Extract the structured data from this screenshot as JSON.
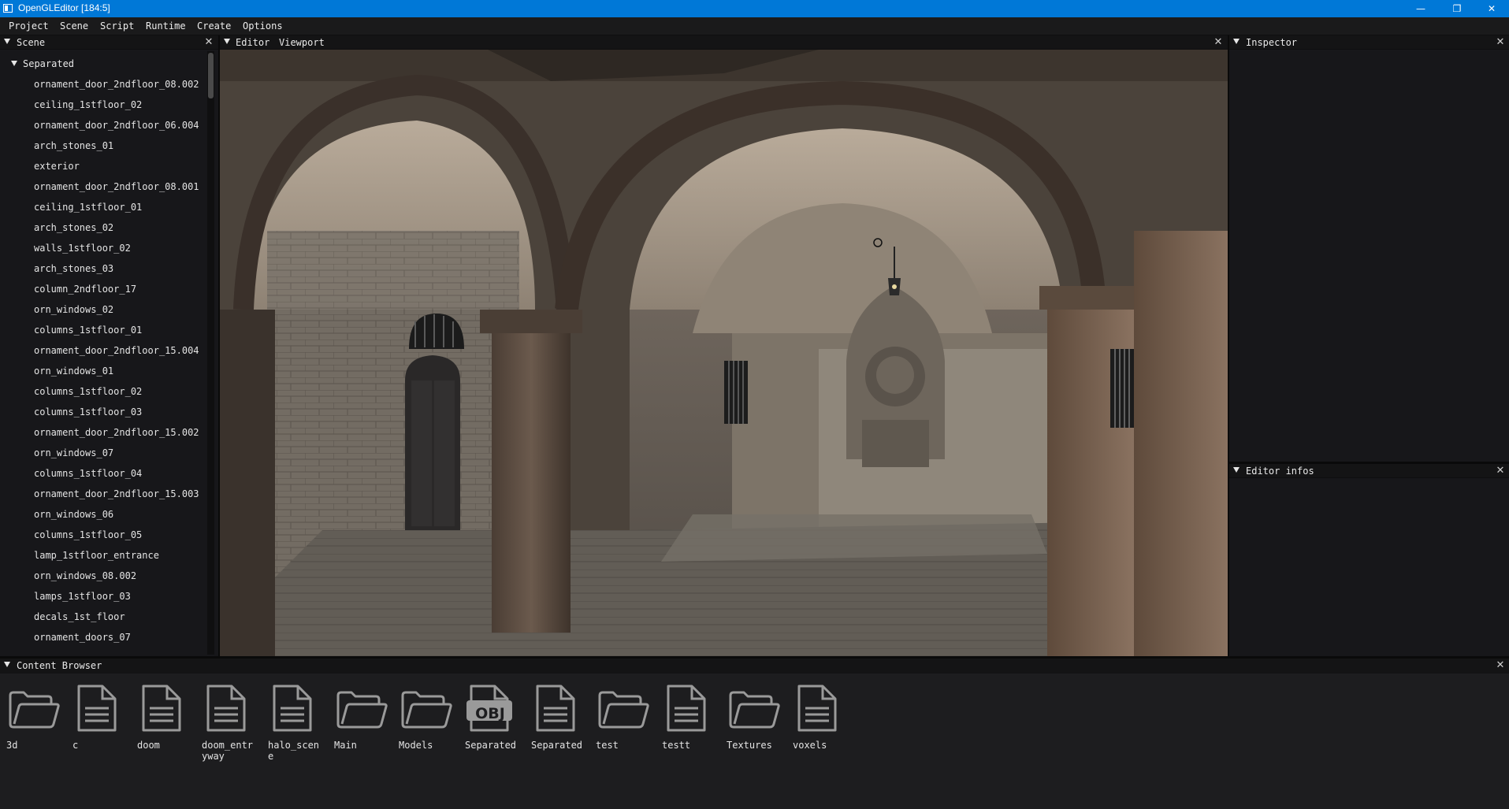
{
  "window": {
    "title": "OpenGLEditor [184:5]",
    "controls": [
      "minimize",
      "maximize",
      "close"
    ]
  },
  "menu": [
    "Project",
    "Scene",
    "Script",
    "Runtime",
    "Create",
    "Options"
  ],
  "scene_panel": {
    "title": "Scene",
    "root": "Separated",
    "items": [
      "ornament_door_2ndfloor_08.002",
      "ceiling_1stfloor_02",
      "ornament_door_2ndfloor_06.004",
      "arch_stones_01",
      "exterior",
      "ornament_door_2ndfloor_08.001",
      "ceiling_1stfloor_01",
      "arch_stones_02",
      "walls_1stfloor_02",
      "arch_stones_03",
      "column_2ndfloor_17",
      "orn_windows_02",
      "columns_1stfloor_01",
      "ornament_door_2ndfloor_15.004",
      "orn_windows_01",
      "columns_1stfloor_02",
      "columns_1stfloor_03",
      "ornament_door_2ndfloor_15.002",
      "orn_windows_07",
      "columns_1stfloor_04",
      "ornament_door_2ndfloor_15.003",
      "orn_windows_06",
      "columns_1stfloor_05",
      "lamp_1stfloor_entrance",
      "orn_windows_08.002",
      "lamps_1stfloor_03",
      "decals_1st_floor",
      "ornament_doors_07"
    ]
  },
  "editor_panel": {
    "title": "Editor",
    "tab": "Viewport"
  },
  "inspector_panel": {
    "title": "Inspector"
  },
  "infos_panel": {
    "title": "Editor infos"
  },
  "content_browser": {
    "title": "Content Browser",
    "items": [
      {
        "name": "3d",
        "icon": "folder-icon"
      },
      {
        "name": "c",
        "icon": "file-icon"
      },
      {
        "name": "doom",
        "icon": "file-icon"
      },
      {
        "name": "doom_entryway",
        "icon": "file-icon"
      },
      {
        "name": "halo_scene",
        "icon": "file-icon"
      },
      {
        "name": "Main",
        "icon": "folder-icon"
      },
      {
        "name": "Models",
        "icon": "folder-icon"
      },
      {
        "name": "Separated",
        "icon": "obj-file-icon",
        "badge": "OBJ"
      },
      {
        "name": "Separated",
        "icon": "file-icon"
      },
      {
        "name": "test",
        "icon": "folder-icon"
      },
      {
        "name": "testt",
        "icon": "file-icon"
      },
      {
        "name": "Textures",
        "icon": "folder-icon"
      },
      {
        "name": "voxels",
        "icon": "file-icon"
      }
    ]
  },
  "colors": {
    "titlebar": "#0078d7",
    "panel_bg": "#17171a",
    "header_bg": "#141415",
    "icon_gray": "#9a9a9a"
  }
}
